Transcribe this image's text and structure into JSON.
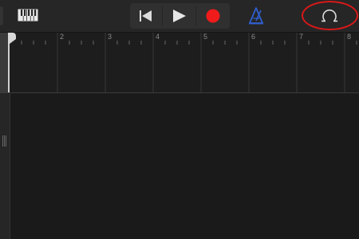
{
  "toolbar": {
    "keyboard_icon": "piano-keyboard-icon",
    "transport": {
      "rewind_icon": "go-to-beginning-icon",
      "play_icon": "play-icon",
      "record_icon": "record-icon"
    },
    "metronome_icon": "metronome-icon",
    "metronome_color": "#2f5fd0",
    "loop_icon": "loop-browser-icon",
    "record_color": "#f01c1c"
  },
  "ruler": {
    "bar_numbers": [
      "2",
      "3",
      "4",
      "5",
      "6",
      "7",
      "8"
    ]
  },
  "highlight_color": "#d81818"
}
